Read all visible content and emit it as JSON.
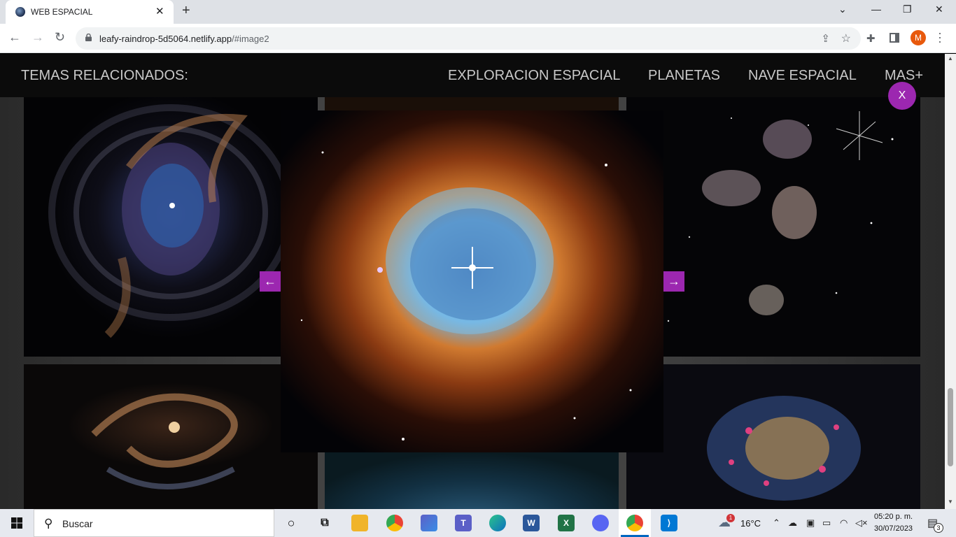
{
  "browser": {
    "tab_title": "WEB ESPACIAL",
    "url_host": "leafy-raindrop-5d5064.netlify.app",
    "url_path": "/#image2",
    "avatar_initial": "M"
  },
  "site": {
    "nav_title": "TEMAS RELACIONADOS:",
    "nav_links": [
      "EXPLORACION ESPACIAL",
      "PLANETAS",
      "NAVE ESPACIAL",
      "MAS+"
    ],
    "close_label": "X",
    "prev_arrow": "←",
    "next_arrow": "→",
    "accent_color": "#9c27b0"
  },
  "taskbar": {
    "search_text": "Buscar",
    "weather_temp": "16°C",
    "weather_badge": "1",
    "time": "05:20 p. m.",
    "date": "30/07/2023",
    "notification_count": "3"
  }
}
